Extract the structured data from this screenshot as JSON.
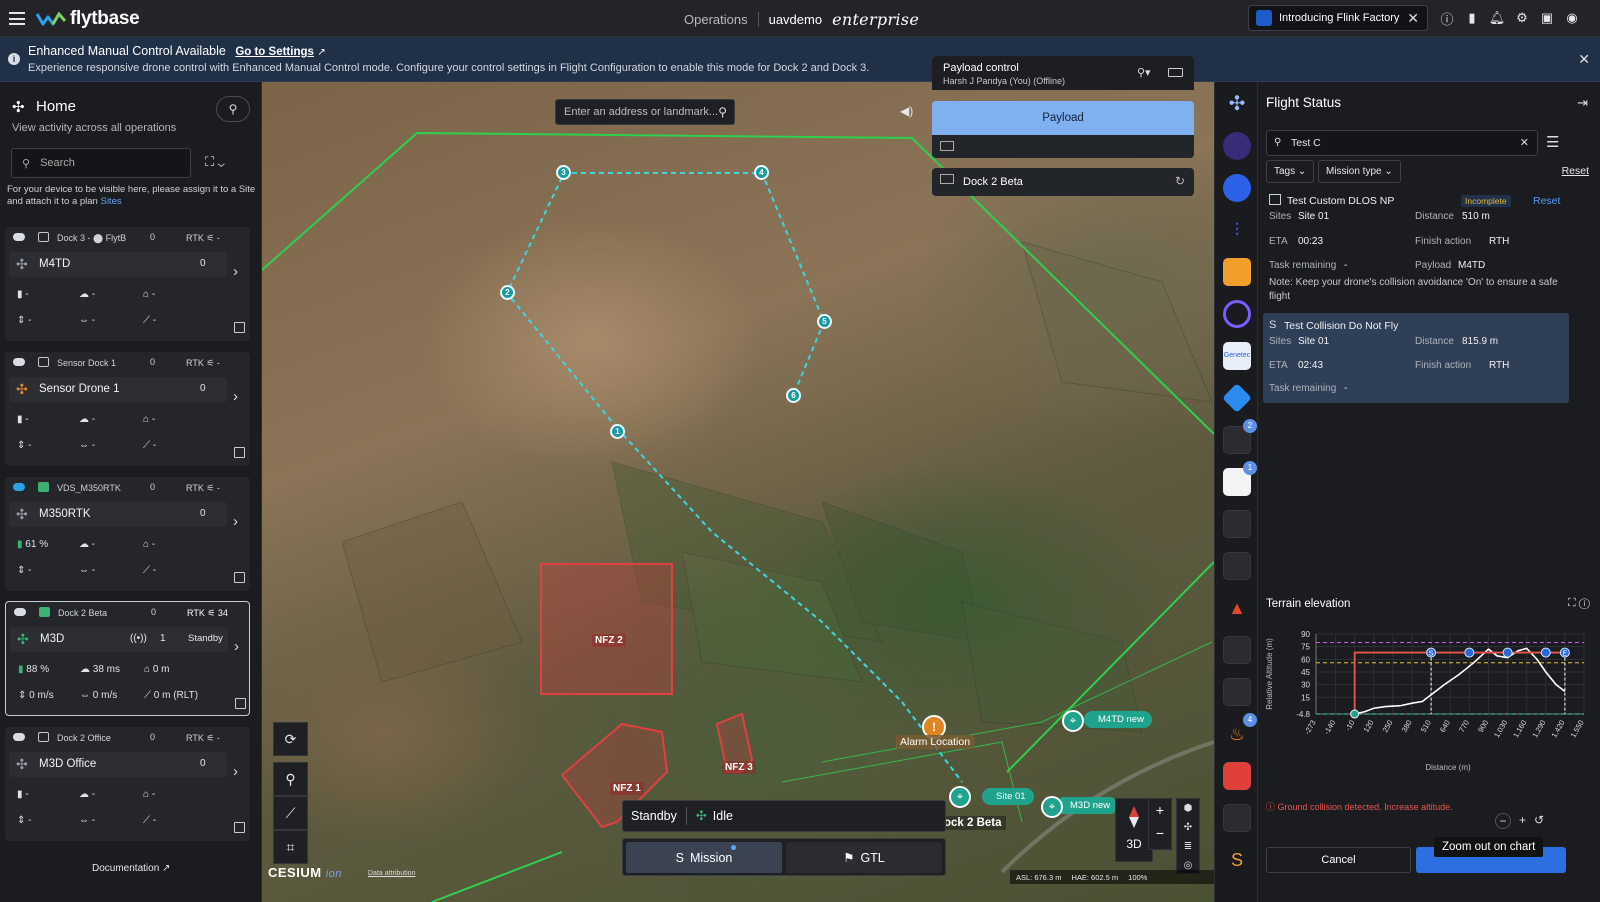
{
  "topbar": {
    "logo_text": "flytbase",
    "operations": "Operations",
    "org": "uavdemo",
    "edition": "enterprise",
    "announcement": "Introducing Flink Factory",
    "icons": [
      "help-icon",
      "analytics-icon",
      "bell-icon",
      "gear-icon",
      "gift-icon",
      "user-icon"
    ]
  },
  "banner": {
    "title": "Enhanced Manual Control Available",
    "link": "Go to Settings",
    "text": "Experience responsive drone control with Enhanced Manual Control mode. Configure your control settings in Flight Configuration to enable this mode for Dock 2 and Dock 3."
  },
  "left": {
    "title": "Home",
    "subtitle": "View activity across all operations",
    "search_placeholder": "Search",
    "note": "For your device to be visible here, please assign it to a Site and attach it to a plan",
    "note_link": "Sites",
    "doc_link": "Documentation",
    "cards": [
      {
        "dock": "Dock 3 - ⬤ FlytB",
        "count": "0",
        "rtk": "RTK",
        "rtk_val": "-",
        "drone": "M4TD",
        "drone_count": "0",
        "battery": "-",
        "wind": "-",
        "home": "-",
        "speed": "-",
        "hspeed": "-",
        "alt": "-",
        "accent": "#9aa0a8"
      },
      {
        "dock": "Sensor Dock 1",
        "count": "0",
        "rtk": "RTK",
        "rtk_val": "-",
        "drone": "Sensor Drone 1",
        "drone_count": "0",
        "battery": "-",
        "wind": "-",
        "home": "-",
        "speed": "-",
        "hspeed": "-",
        "alt": "-",
        "accent": "#e8872a"
      },
      {
        "dock": "VDS_M350RTK",
        "count": "0",
        "rtk": "RTK",
        "rtk_val": "-",
        "drone": "M350RTK",
        "drone_count": "0",
        "battery": "61 %",
        "wind": "-",
        "home": "-",
        "speed": "-",
        "hspeed": "-",
        "alt": "-",
        "accent": "#9aa0a8"
      },
      {
        "dock": "Dock 2 Beta",
        "count": "0",
        "rtk": "RTK",
        "rtk_val": "34",
        "drone": "M3D",
        "drone_count": "1",
        "status": "Standby",
        "battery": "88 %",
        "wind": "38 ms",
        "home": "0 m",
        "speed": "0 m/s",
        "hspeed": "0 m/s",
        "alt": "0 m (RLT)",
        "accent": "#3bb273"
      },
      {
        "dock": "Dock 2 Office",
        "count": "0",
        "rtk": "RTK",
        "rtk_val": "-",
        "drone": "M3D Office",
        "drone_count": "0",
        "battery": "-",
        "wind": "-",
        "home": "-",
        "speed": "-",
        "hspeed": "-",
        "alt": "-",
        "accent": "#9aa0a8"
      }
    ]
  },
  "map": {
    "search_placeholder": "Enter an address or landmark...",
    "nfz": [
      "NFZ 2",
      "NFZ 1",
      "NFZ 3"
    ],
    "waypoints": [
      "1",
      "2",
      "3",
      "4",
      "5",
      "6"
    ],
    "alarm_label": "Alarm Location",
    "pins": [
      "M4TD new",
      "Site 01",
      "M3D new"
    ],
    "dock_label": "ock 2 Beta",
    "status": "Standby",
    "drone_state": "Idle",
    "tabs": [
      "Mission",
      "GTL"
    ],
    "view_mode": "3D",
    "brand": "CESIUM",
    "brand_sub": "ion",
    "attribution": "Data attribution",
    "asl": "ASL: 676.3 m",
    "hae": "HAE: 602.5 m",
    "zoom": "100%"
  },
  "payload": {
    "title": "Payload control",
    "user": "Harsh J Pandya (You) (Offline)",
    "button": "Payload",
    "dock_camera": "Dock 2 Beta"
  },
  "rail": {
    "badges": [
      "2",
      "1",
      "4"
    ]
  },
  "flight_status": {
    "title": "Flight Status",
    "search_value": "Test C",
    "filters": [
      "Tags",
      "Mission type"
    ],
    "reset": "Reset",
    "missions": [
      {
        "name": "Test Custom DLOS NP",
        "badge": "Incomplete",
        "reset": "Reset",
        "sites_label": "Sites",
        "sites": "Site 01",
        "distance_label": "Distance",
        "distance": "510 m",
        "eta_label": "ETA",
        "eta": "00:23",
        "finish_label": "Finish action",
        "finish": "RTH",
        "task_label": "Task remaining",
        "task": "-",
        "payload_label": "Payload",
        "payload": "M4TD",
        "note": "Note: Keep your drone's collision avoidance 'On' to ensure a safe flight"
      },
      {
        "name": "Test Collision Do Not Fly",
        "sites_label": "Sites",
        "sites": "Site 01",
        "distance_label": "Distance",
        "distance": "815.9 m",
        "eta_label": "ETA",
        "eta": "02:43",
        "finish_label": "Finish action",
        "finish": "RTH",
        "task_label": "Task remaining",
        "task": "-"
      }
    ],
    "terrain_title": "Terrain elevation",
    "warning": "Ground collision detected. Increase altitude.",
    "cancel": "Cancel",
    "tooltip": "Zoom out on chart"
  },
  "chart_data": {
    "type": "line",
    "title": "Terrain elevation",
    "xlabel": "Distance (m)",
    "ylabel": "Relative Altitude (m)",
    "x_ticks": [
      "-273",
      "-140",
      "-10",
      "120",
      "250",
      "380",
      "510",
      "640",
      "770",
      "900",
      "1,030",
      "1,160",
      "1,290",
      "1,420",
      "1,550"
    ],
    "y_ticks": [
      "90",
      "75",
      "60",
      "45",
      "30",
      "15",
      "-4.8"
    ],
    "ylim": [
      -4.8,
      90
    ],
    "xlim": [
      -273,
      1550
    ],
    "series": [
      {
        "name": "terrain",
        "x": [
          -10,
          60,
          120,
          200,
          300,
          380,
          450,
          510,
          600,
          700,
          800,
          900,
          960,
          1030,
          1100,
          1160,
          1230,
          1290,
          1360,
          1420
        ],
        "values": [
          -4.8,
          -2,
          2,
          4,
          5,
          8,
          10,
          18,
          30,
          42,
          56,
          72,
          64,
          62,
          70,
          73,
          60,
          45,
          30,
          22
        ]
      },
      {
        "name": "mission",
        "x": [
          -10,
          -10,
          510,
          770,
          1030,
          1290,
          1420
        ],
        "values": [
          -4.8,
          68,
          68,
          68,
          68,
          68,
          68
        ]
      }
    ],
    "reference_lines": [
      80,
      56,
      -4.8
    ],
    "markers": [
      "S",
      "E"
    ]
  }
}
